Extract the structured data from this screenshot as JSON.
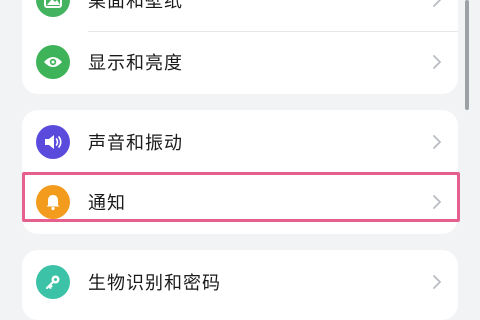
{
  "settings": {
    "items": [
      {
        "label": "桌面和壁纸",
        "icon": "wallpaper-icon",
        "color": "#43b35f"
      },
      {
        "label": "显示和亮度",
        "icon": "eye-icon",
        "color": "#3fb359"
      },
      {
        "label": "声音和振动",
        "icon": "speaker-icon",
        "color": "#5b4bdc"
      },
      {
        "label": "通知",
        "icon": "bell-icon",
        "color": "#f39b1c"
      },
      {
        "label": "生物识别和密码",
        "icon": "key-icon",
        "color": "#3cc2a6"
      }
    ],
    "highlight_color": "#e6608f"
  }
}
